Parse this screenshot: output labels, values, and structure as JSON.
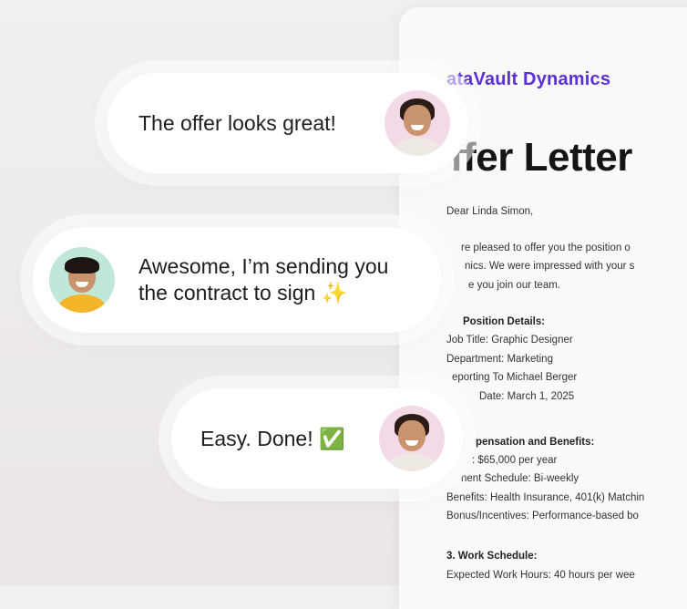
{
  "document": {
    "brand": "ataVault Dynamics",
    "title": "ffer Letter",
    "greeting": "Dear Linda Simon,",
    "intro_lines": [
      "re pleased to offer you the position o",
      "nics. We were impressed with your s",
      "e you join our team."
    ],
    "section1_heading": "Position Details:",
    "section1_lines": [
      "Job Title: Graphic Designer",
      "Department: Marketing",
      "eporting To Michael Berger",
      "Date: March 1, 2025"
    ],
    "section2_heading": "pensation and Benefits:",
    "section2_lines": [
      ": $65,000 per year",
      "nent Schedule: Bi-weekly",
      "Benefits: Health Insurance, 401(k) Matchin",
      "Bonus/Incentives: Performance-based bo"
    ],
    "section3_heading": "3. Work Schedule:",
    "section3_lines": [
      "Expected Work Hours: 40 hours per wee"
    ]
  },
  "chat": {
    "message1": "The offer looks great!",
    "message2_line1": "Awesome, I’m sending you",
    "message2_line2": "the contract to sign ✨",
    "message3": "Easy. Done! ✅"
  }
}
